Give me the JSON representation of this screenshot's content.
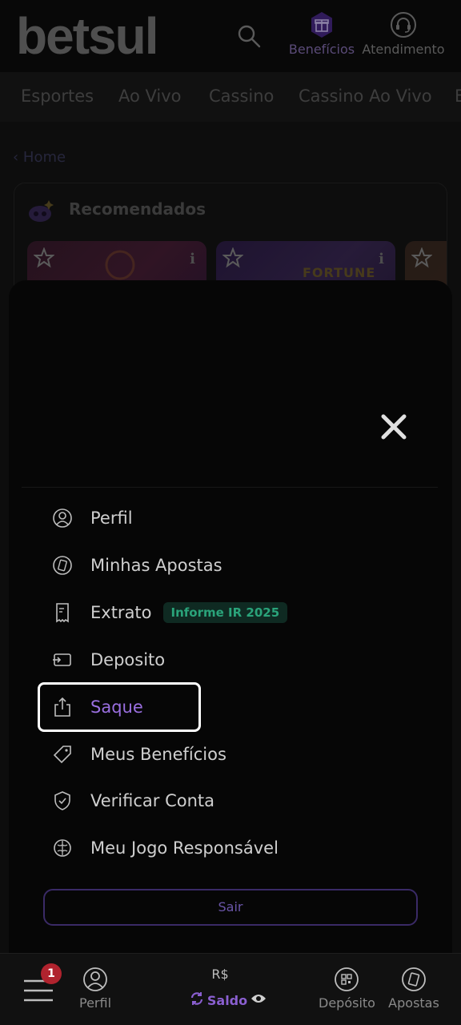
{
  "header": {
    "logo_text": "betsul",
    "beneficios_label": "Benefícios",
    "atendimento_label": "Atendimento"
  },
  "nav": {
    "items": [
      "Esportes",
      "Ao Vivo",
      "Cassino",
      "Cassino Ao Vivo",
      "E"
    ]
  },
  "breadcrumb": {
    "home": "‹ Home"
  },
  "recommended": {
    "title": "Recomendados",
    "tile_info_glyph": "i",
    "tile2_text": "FORTUNE"
  },
  "drawer": {
    "close_icon": "close-icon",
    "menu": [
      {
        "label": "Perfil",
        "icon": "user-circle-icon"
      },
      {
        "label": "Minhas Apostas",
        "icon": "ticket-icon"
      },
      {
        "label": "Extrato",
        "icon": "receipt-icon",
        "badge": "Informe IR 2025"
      },
      {
        "label": "Deposito",
        "icon": "wallet-in-icon"
      },
      {
        "label": "Saque",
        "icon": "share-out-icon",
        "active": true
      },
      {
        "label": "Meus Benefícios",
        "icon": "tag-icon"
      },
      {
        "label": "Verificar Conta",
        "icon": "shield-check-icon"
      },
      {
        "label": "Meu Jogo Responsável",
        "icon": "brain-icon"
      }
    ],
    "logout_label": "Sair"
  },
  "bottom_bar": {
    "notification_count": "1",
    "perfil_label": "Perfil",
    "currency": "R$",
    "saldo_label": "Saldo",
    "deposito_label": "Depósito",
    "apostas_label": "Apostas"
  },
  "colors": {
    "accent_purple": "#8a5fd0",
    "badge_green": "#2aa37a",
    "notification_red": "#b0232e"
  }
}
